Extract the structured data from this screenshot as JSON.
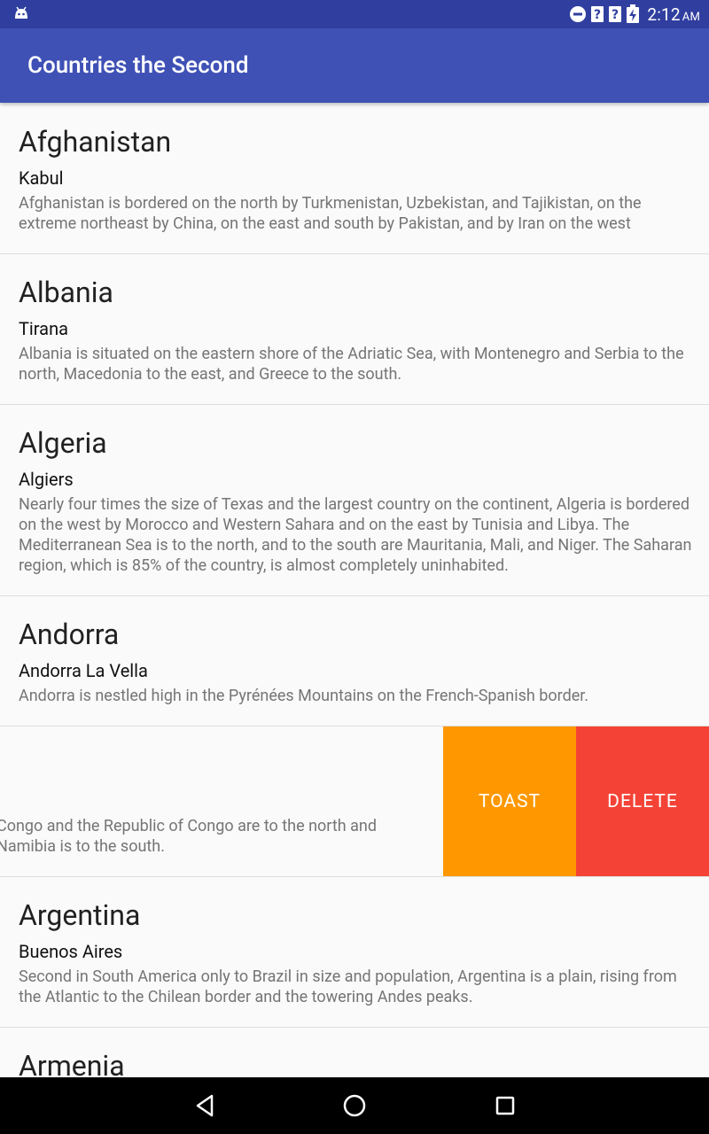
{
  "status_bar": {
    "time": "2:12",
    "ampm": "AM"
  },
  "app_bar": {
    "title": "Countries the Second"
  },
  "countries": [
    {
      "name": "Afghanistan",
      "capital": "Kabul",
      "description": "Afghanistan is bordered on the north by Turkmenistan, Uzbekistan, and Tajikistan, on the extreme northeast by China, on the east and south by Pakistan, and by Iran on the west"
    },
    {
      "name": "Albania",
      "capital": "Tirana",
      "description": "Albania is situated on the eastern shore of the Adriatic Sea, with Montenegro and Serbia to the north, Macedonia to the east, and Greece to the south."
    },
    {
      "name": "Algeria",
      "capital": "Algiers",
      "description": "Nearly four times the size of Texas and the largest country on the continent, Algeria is bordered on the west by Morocco and Western Sahara and on the east by Tunisia and Libya. The Mediterranean Sea is to the north, and to the south are Mauritania, Mali, and Niger. The Saharan region, which is 85% of the country, is almost completely uninhabited."
    },
    {
      "name": "Andorra",
      "capital": "Andorra La Vella",
      "description": "Andorra is nestled high in the Pyrénées Mountains on the French-Spanish border."
    },
    {
      "description_line1": "Congo and the Republic of Congo are to the north and",
      "description_line2": "Namibia is to the south."
    },
    {
      "name": "Argentina",
      "capital": "Buenos Aires",
      "description": "Second in South America only to Brazil in size and population, Argentina is a plain, rising from the Atlantic to the Chilean border and the towering Andes peaks."
    },
    {
      "name": "Armenia"
    }
  ],
  "swipe_actions": {
    "toast_label": "TOAST",
    "delete_label": "DELETE",
    "toast_color": "#ff9800",
    "delete_color": "#f44336"
  },
  "colors": {
    "primary": "#3f51b5",
    "primary_dark": "#303f9f"
  },
  "icons": [
    "android-debug-icon",
    "do-not-disturb-icon",
    "signal-unknown-icon",
    "battery-charging-icon",
    "back-icon",
    "home-icon",
    "recents-icon"
  ]
}
